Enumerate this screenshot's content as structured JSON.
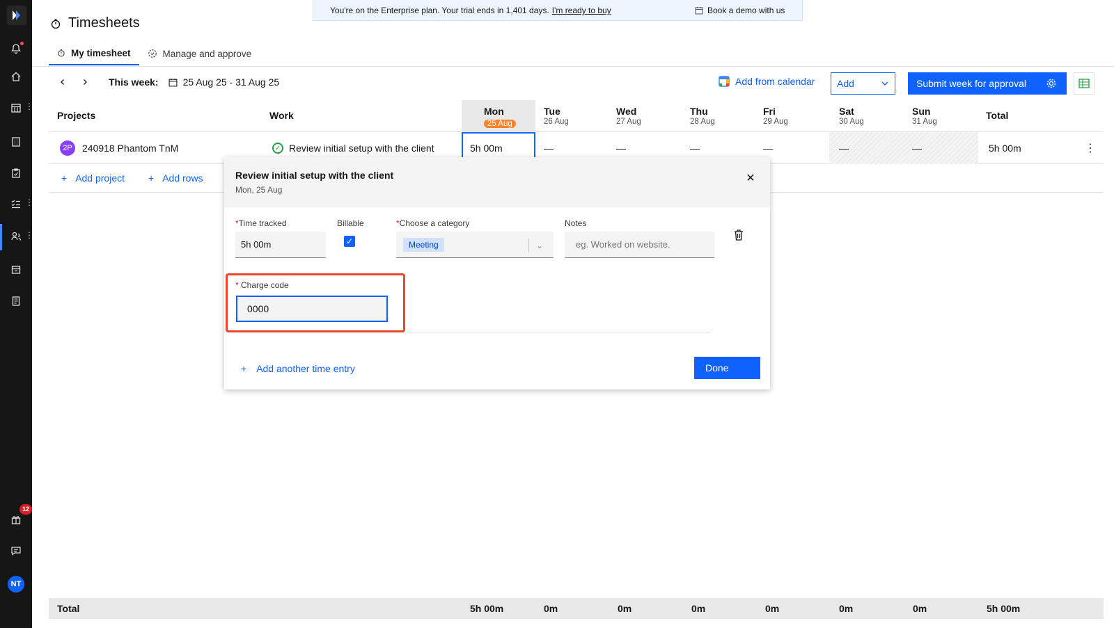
{
  "trial": {
    "message": "You're on the Enterprise plan. Your trial ends in 1,401 days.",
    "buy_link": "I'm ready to buy",
    "demo_link": "Book a demo with us"
  },
  "header": {
    "title": "Timesheets",
    "tabs": [
      {
        "label": "My timesheet",
        "active": true
      },
      {
        "label": "Manage and approve",
        "active": false
      }
    ]
  },
  "toolbar": {
    "week_label": "This week:",
    "week_range": "25 Aug 25 - 31 Aug 25",
    "add_from_calendar": "Add from calendar",
    "add_select": "Add",
    "submit_label": "Submit week for approval"
  },
  "grid": {
    "col_projects": "Projects",
    "col_work": "Work",
    "col_total": "Total",
    "days": [
      {
        "day": "Mon",
        "date": "25 Aug",
        "today": true
      },
      {
        "day": "Tue",
        "date": "26 Aug"
      },
      {
        "day": "Wed",
        "date": "27 Aug"
      },
      {
        "day": "Thu",
        "date": "28 Aug"
      },
      {
        "day": "Fri",
        "date": "29 Aug"
      },
      {
        "day": "Sat",
        "date": "30 Aug"
      },
      {
        "day": "Sun",
        "date": "31 Aug"
      }
    ],
    "row": {
      "avatar": "2P",
      "project": "240918 Phantom TnM",
      "work": "Review initial setup with the client",
      "mon": "5h 00m",
      "tue": "—",
      "wed": "—",
      "thu": "—",
      "fri": "—",
      "sat": "—",
      "sun": "—",
      "total": "5h 00m"
    },
    "add_project": "Add project",
    "add_rows": "Add rows"
  },
  "popover": {
    "title": "Review initial setup with the client",
    "date": "Mon, 25 Aug",
    "time_label": "Time tracked",
    "time_value": "5h 00m",
    "billable_label": "Billable",
    "billable_checked": true,
    "category_label": "Choose a category",
    "category_value": "Meeting",
    "notes_label": "Notes",
    "notes_placeholder": "eg. Worked on website.",
    "charge_label": "Charge code",
    "charge_value": "0000",
    "add_entry": "Add another time entry",
    "done": "Done"
  },
  "totals": {
    "label": "Total",
    "mon": "5h 00m",
    "tue": "0m",
    "wed": "0m",
    "thu": "0m",
    "fri": "0m",
    "sat": "0m",
    "sun": "0m",
    "total": "5h 00m"
  },
  "sidebar": {
    "notification_badge": "12",
    "user_initials": "NT"
  },
  "colors": {
    "accent": "#0f62fe",
    "today": "#ff832b",
    "highlight": "#e8472a",
    "sidebar": "#161616"
  }
}
